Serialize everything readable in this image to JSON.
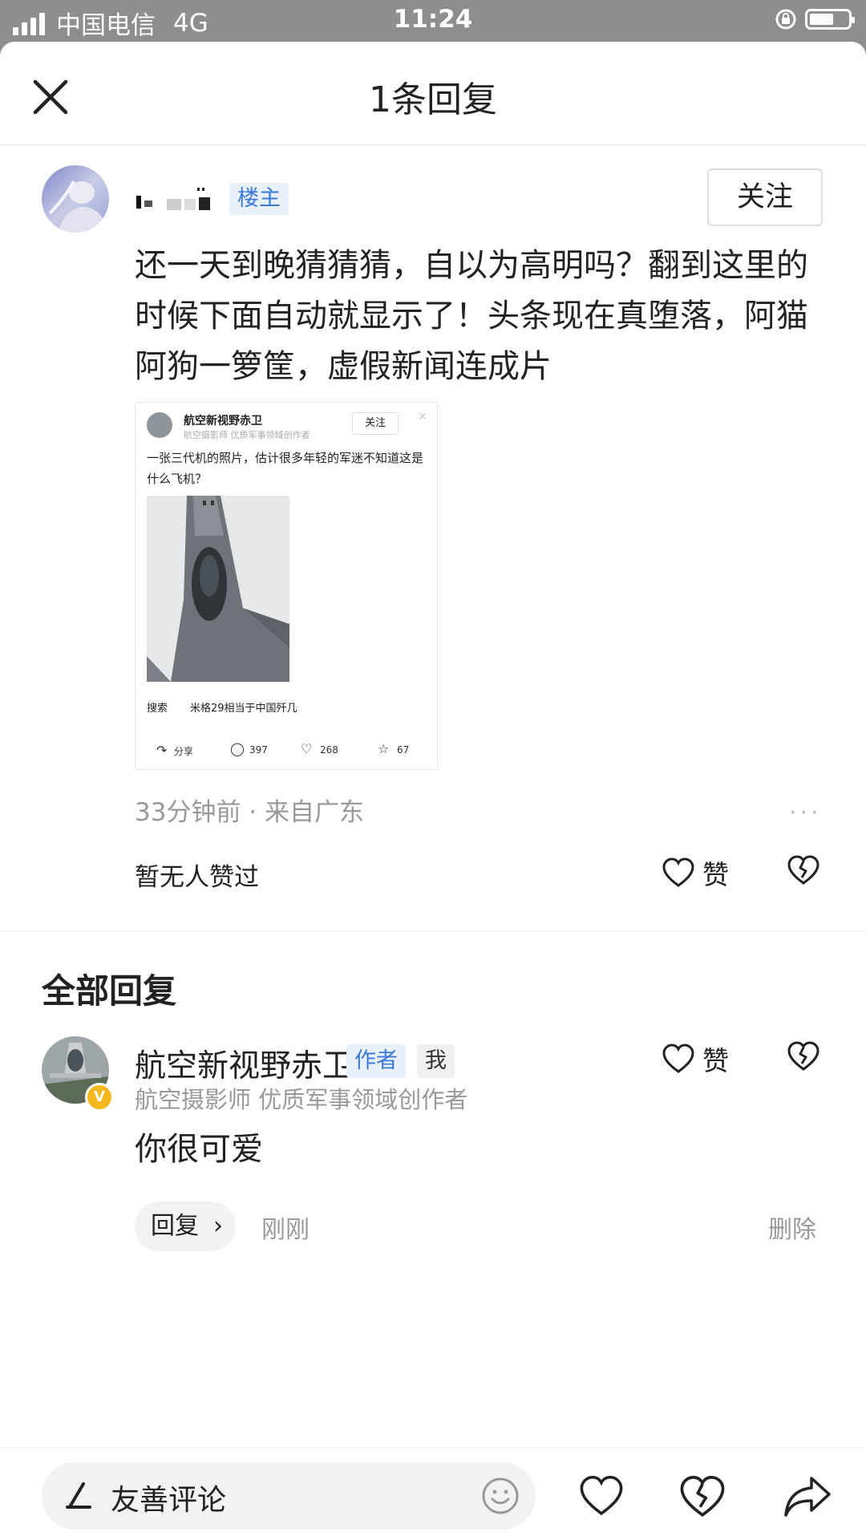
{
  "status_bar": {
    "carrier": "中国电信",
    "network": "4G",
    "time": "11:24"
  },
  "header": {
    "title": "1条回复"
  },
  "post": {
    "username_masked": "▮ ▪▪▪▮",
    "op_badge": "楼主",
    "follow_label": "关注",
    "text": "还一天到晚猜猜猜，自以为高明吗？翻到这里的时候下面自动就显示了！头条现在真堕落，阿猫阿狗一箩筐，虚假新闻连成片",
    "screenshot": {
      "account": "航空新视野赤卫",
      "account_sub": "航空摄影师 优质军事领域创作者",
      "follow": "关注",
      "caption": "一张三代机的照片，估计很多年轻的军迷不知道这是什么飞机？",
      "search_label": "搜索",
      "search_query": "米格29相当于中国歼几",
      "share": "分享",
      "comments": "397",
      "likes": "268",
      "favorites": "67"
    },
    "meta": "33分钟前 · 来自广东",
    "no_likes": "暂无人赞过",
    "like_label": "赞"
  },
  "all_replies": {
    "title": "全部回复",
    "items": [
      {
        "name": "航空新视野赤卫",
        "author_tag": "作者",
        "me_tag": "我",
        "subtitle": "航空摄影师 优质军事领域创作者",
        "text": "你很可爱",
        "reply_label": "回复",
        "time": "刚刚",
        "delete_label": "删除",
        "like_label": "赞"
      }
    ]
  },
  "bottom_bar": {
    "placeholder": "友善评论"
  },
  "colors": {
    "accent": "#3c7ad8",
    "tag_bg": "#e8f0fb",
    "muted": "#999999",
    "verified": "#f5b81c"
  }
}
